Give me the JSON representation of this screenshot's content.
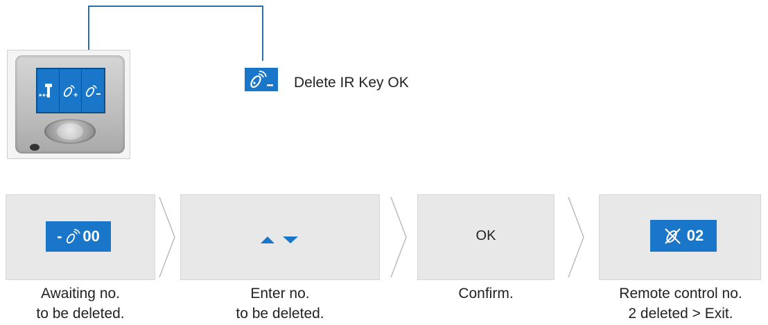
{
  "mode": {
    "icon": "remote-key-minus-icon",
    "label": "Delete IR Key OK"
  },
  "device": {
    "screen_icons": [
      "wrench-icon",
      "remote-key-plus-icon",
      "remote-key-minus-icon"
    ],
    "stars": "***"
  },
  "steps": [
    {
      "display": "00",
      "display_prefix": "-",
      "display_icon": "remote-key-icon",
      "caption_line1": "Awaiting no.",
      "caption_line2": "to be deleted."
    },
    {
      "display_icon": "up-down-arrows-icon",
      "caption_line1": "Enter no.",
      "caption_line2": "to be deleted."
    },
    {
      "display": "OK",
      "caption_line1": "Confirm.",
      "caption_line2": ""
    },
    {
      "display": "02",
      "display_icon": "remote-key-crossed-icon",
      "caption_line1": "Remote control no.",
      "caption_line2": "2 deleted > Exit."
    }
  ],
  "colors": {
    "accent_blue": "#1a76c8",
    "box_gray": "#e8e8e8",
    "line_blue": "#2a6fa8"
  }
}
